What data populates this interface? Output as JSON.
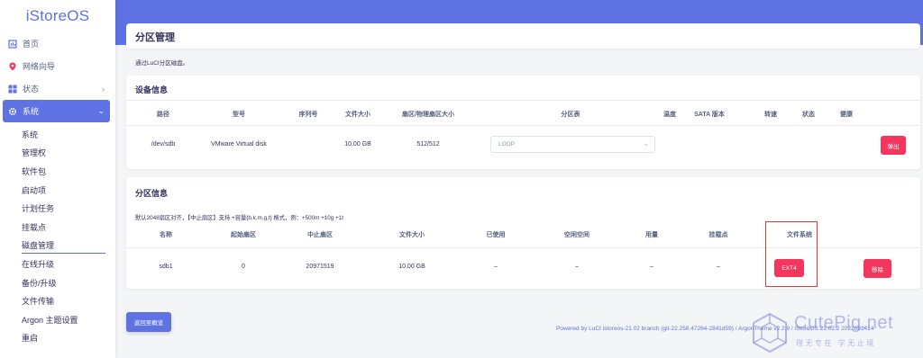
{
  "sidebar": {
    "brand": "iStoreOS",
    "items": [
      {
        "label": "首页",
        "icon": "home-icon"
      },
      {
        "label": "网络向导",
        "icon": "wizard-icon"
      },
      {
        "label": "状态",
        "icon": "grid-icon"
      },
      {
        "label": "系统",
        "icon": "gear-icon"
      }
    ],
    "sub_items": [
      "系统",
      "管理权",
      "软件包",
      "启动项",
      "计划任务",
      "挂载点",
      "磁盘管理",
      "在线升级",
      "备份/升级",
      "文件传输",
      "Argon 主题设置",
      "重启"
    ],
    "current_sub": "磁盘管理"
  },
  "page": {
    "title": "分区管理",
    "description": "通过LuCI分区磁盘。"
  },
  "device_info": {
    "heading": "设备信息",
    "headers": [
      "路径",
      "型号",
      "序列号",
      "文件大小",
      "扇区/物理扇区大小",
      "分区表",
      "温度",
      "SATA 版本",
      "转速",
      "状态",
      "健康"
    ],
    "row": {
      "path": "/dev/sdb",
      "model": "VMware Virtual disk",
      "serial": "",
      "size": "10.00 GB",
      "sector": "512/512",
      "partition_table": "LOOP"
    },
    "eject_label": "弹出"
  },
  "partition_info": {
    "heading": "分区信息",
    "note": "默认2048扇区对齐，【中止扇区】支持 +容量{b,k,m,g,t} 格式，例：+500m +10g +1t",
    "headers": [
      "名称",
      "起始扇区",
      "中止扇区",
      "文件大小",
      "已使用",
      "空闲空间",
      "用量",
      "挂载点",
      "文件系统"
    ],
    "row": {
      "name": "sdb1",
      "start": "0",
      "end": "20971519",
      "size": "10.00 GB",
      "used": "–",
      "free": "–",
      "usage": "–",
      "mount": "–",
      "fs": "EXT4"
    },
    "remove_label": "移除"
  },
  "back_label": "返回至概览",
  "footer": "Powered by LuCI istoreos-21.02 branch (git-22.258.47264-2841d59) / ArgonTheme v2.2.9 / iStoreOS 21.02.2 2022091414",
  "watermark": {
    "name": "CutePig.net",
    "slogan": "理无专在 学无止境"
  }
}
